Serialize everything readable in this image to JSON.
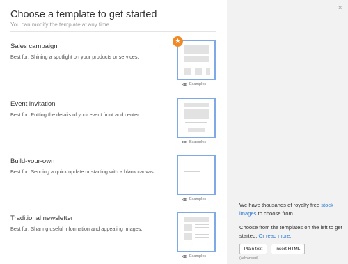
{
  "header": {
    "title": "Choose a template to get started",
    "subtitle": "You can modify the template at any time."
  },
  "templates": [
    {
      "name": "Sales campaign",
      "best_for": "Best for: Shining a spotlight on your products or services.",
      "examples_label": "Examples",
      "featured": true
    },
    {
      "name": "Event invitation",
      "best_for": "Best for: Putting the details of your event front and center.",
      "examples_label": "Examples"
    },
    {
      "name": "Build-your-own",
      "best_for": "Best for: Sending a quick update or starting with a blank canvas.",
      "examples_label": "Examples"
    },
    {
      "name": "Traditional newsletter",
      "best_for": "Best for: Sharing useful information and appealing images.",
      "examples_label": "Examples"
    }
  ],
  "featured_badge": {
    "icon": "star-icon",
    "glyph": "★",
    "color": "#f08a24"
  },
  "sidebar": {
    "close_glyph": "×",
    "stock_text_before": "We have thousands of royalty free ",
    "stock_link": "stock images",
    "stock_text_after": " to choose from.",
    "choose_text": "Choose from the templates on the left to get started.",
    "read_more_link": "Or read more.",
    "plain_text_button": "Plain text",
    "insert_html_button": "Insert HTML",
    "advanced_note": "(advanced)"
  },
  "colors": {
    "accent": "#2f7bd1",
    "thumb_border": "#7fa8e6",
    "side_bg": "#f2f2f2"
  }
}
